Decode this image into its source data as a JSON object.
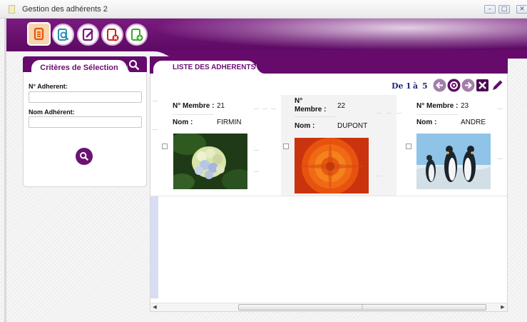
{
  "window": {
    "title": "Gestion des adhérents 2",
    "controls": [
      "minimize-icon",
      "restore-icon",
      "close-icon"
    ]
  },
  "toolbar": {
    "buttons": [
      {
        "name": "list",
        "icon": "document-list-icon",
        "color": "#e25a0a",
        "selected": true
      },
      {
        "name": "view",
        "icon": "document-search-icon",
        "color": "#2a8fb7"
      },
      {
        "name": "edit",
        "icon": "document-edit-icon",
        "color": "#7a1a80"
      },
      {
        "name": "delete",
        "icon": "document-delete-icon",
        "color": "#d62020"
      },
      {
        "name": "add",
        "icon": "document-add-icon",
        "color": "#3ea82e"
      }
    ]
  },
  "criteria": {
    "title": "Critères de Sélection",
    "fields": [
      {
        "label": "N° Adherent:",
        "value": ""
      },
      {
        "label": "Nom Adhérent:",
        "value": ""
      }
    ]
  },
  "list": {
    "title": "LISTE DES ADHERENTS",
    "pager": {
      "de": "De",
      "from": "1",
      "a": "à",
      "to": "5"
    },
    "nav_icons": [
      "previous-icon",
      "reload-icon",
      "next-icon",
      "excel-export-icon",
      "pencil-icon"
    ],
    "member_label": "N° Membre :",
    "name_label": "Nom :",
    "members": [
      {
        "id": "21",
        "name": "FIRMIN",
        "photo": "hydrangea"
      },
      {
        "id": "22",
        "name": "DUPONT",
        "photo": "orange-chrysanthemum"
      },
      {
        "id": "23",
        "name": "ANDRE",
        "photo": "penguins"
      }
    ]
  },
  "colors": {
    "brand": "#660a6c",
    "pager_text": "#232a7a"
  }
}
